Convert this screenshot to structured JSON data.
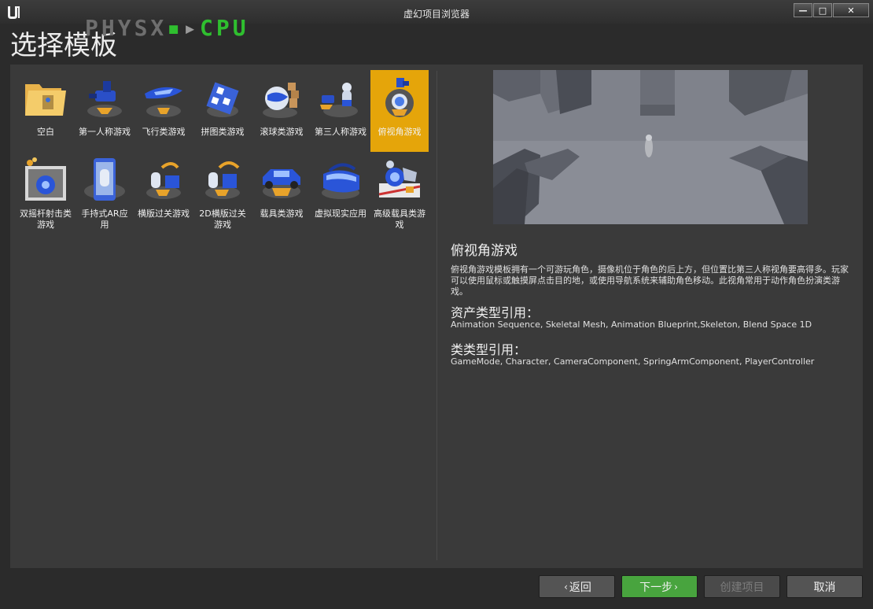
{
  "window": {
    "title": "虚幻项目浏览器",
    "min_glyph": "—",
    "max_glyph": "□",
    "close_glyph": "✕"
  },
  "overlay": {
    "part1": "PHYSX",
    "part2": "▪",
    "part3": "▸",
    "part4": "CPU"
  },
  "page": {
    "heading": "选择模板"
  },
  "templates": [
    {
      "label": "空白",
      "icon": "blank-folder-icon",
      "selected": false
    },
    {
      "label": "第一人称游戏",
      "icon": "first-person-icon",
      "selected": false
    },
    {
      "label": "飞行类游戏",
      "icon": "flying-icon",
      "selected": false
    },
    {
      "label": "拼图类游戏",
      "icon": "puzzle-icon",
      "selected": false
    },
    {
      "label": "滚球类游戏",
      "icon": "rolling-ball-icon",
      "selected": false
    },
    {
      "label": "第三人称游戏",
      "icon": "third-person-icon",
      "selected": false
    },
    {
      "label": "俯视角游戏",
      "icon": "top-down-icon",
      "selected": true
    },
    {
      "label": "双摇杆射击类游戏",
      "icon": "twin-stick-shooter-icon",
      "selected": false
    },
    {
      "label": "手持式AR应用",
      "icon": "handheld-ar-icon",
      "selected": false
    },
    {
      "label": "横版过关游戏",
      "icon": "side-scroller-icon",
      "selected": false
    },
    {
      "label": "2D横版过关游戏",
      "icon": "side-scroller-2d-icon",
      "selected": false
    },
    {
      "label": "载具类游戏",
      "icon": "vehicle-icon",
      "selected": false
    },
    {
      "label": "虚拟现实应用",
      "icon": "vr-headset-icon",
      "selected": false
    },
    {
      "label": "高级载具类游戏",
      "icon": "advanced-vehicle-icon",
      "selected": false
    }
  ],
  "detail": {
    "title": "俯视角游戏",
    "description": "俯视角游戏模板拥有一个可游玩角色，摄像机位于角色的后上方，但位置比第三人称视角要高得多。玩家可以使用鼠标或触摸屏点击目的地，或使用导航系统来辅助角色移动。此视角常用于动作角色扮演类游戏。",
    "assets_heading": "资产类型引用：",
    "assets_value": "Animation Sequence, Skeletal Mesh, Animation Blueprint,Skeleton, Blend Space 1D",
    "classes_heading": "类类型引用：",
    "classes_value": "GameMode, Character, CameraComponent, SpringArmComponent, PlayerController"
  },
  "footer": {
    "back_label": "返回",
    "next_label": "下一步",
    "create_label": "创建项目",
    "cancel_label": "取消",
    "back_chevron": "‹",
    "next_chevron": "›"
  },
  "colors": {
    "selected_tile": "#e5a50a",
    "next_button": "#48a43e",
    "physx_green": "#2fbf2f",
    "panel": "#3a3a3a",
    "background": "#2b2b2b"
  }
}
